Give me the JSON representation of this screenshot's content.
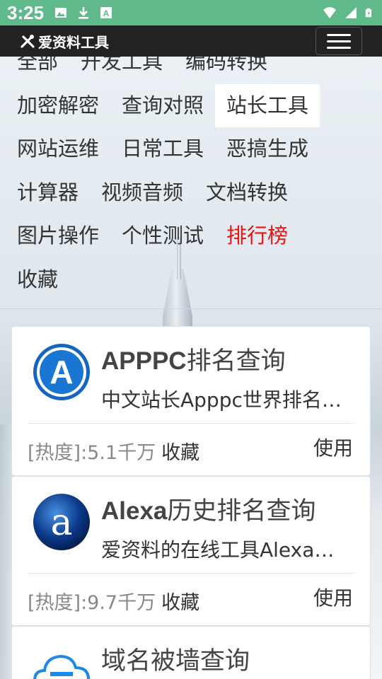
{
  "status_bar": {
    "time": "3:25",
    "left_icons": [
      "image-icon",
      "download-icon",
      "a-box-icon"
    ],
    "right_icons": [
      "wifi-icon",
      "signal-icon",
      "battery-icon"
    ],
    "color": "#5fb98a"
  },
  "app_bar": {
    "logo_text": "爱资料工具",
    "logo_icon": "tools-icon",
    "menu_icon": "hamburger-menu-icon"
  },
  "categories": [
    [
      "全部",
      "开发工具",
      "编码转换"
    ],
    [
      "加密解密",
      "查询对照",
      "站长工具"
    ],
    [
      "网站运维",
      "日常工具",
      "恶搞生成"
    ],
    [
      "计算器",
      "视频音频",
      "文档转换"
    ],
    [
      "图片操作",
      "个性测试",
      "排行榜"
    ],
    [
      "收藏"
    ]
  ],
  "active_category": "站长工具",
  "hot_category": "排行榜",
  "cards": [
    {
      "icon": "apppc-a-icon",
      "title_bold": "APPPC",
      "title_rest": "排名查询",
      "desc": "中文站长Apppc世界排名查询",
      "heat_label": "[热度]:5.1千万",
      "fav_label": "收藏",
      "use_label": "使用"
    },
    {
      "icon": "alexa-a-icon",
      "title_bold": "Alexa",
      "title_rest": "历史排名查询",
      "desc": "爱资料的在线工具Alexa历史排名查询",
      "heat_label": "[热度]:9.7千万",
      "fav_label": "收藏",
      "use_label": "使用"
    },
    {
      "icon": "cloud-wall-icon",
      "title_bold": "",
      "title_rest": "域名被墙查询",
      "desc": "",
      "heat_label": "",
      "fav_label": "",
      "use_label": ""
    }
  ],
  "colors": {
    "accent_active_bg": "#ffffff",
    "hot_text": "#ee1111",
    "app_bar_bg": "#222222",
    "apppc_blue": "#1565c0"
  }
}
